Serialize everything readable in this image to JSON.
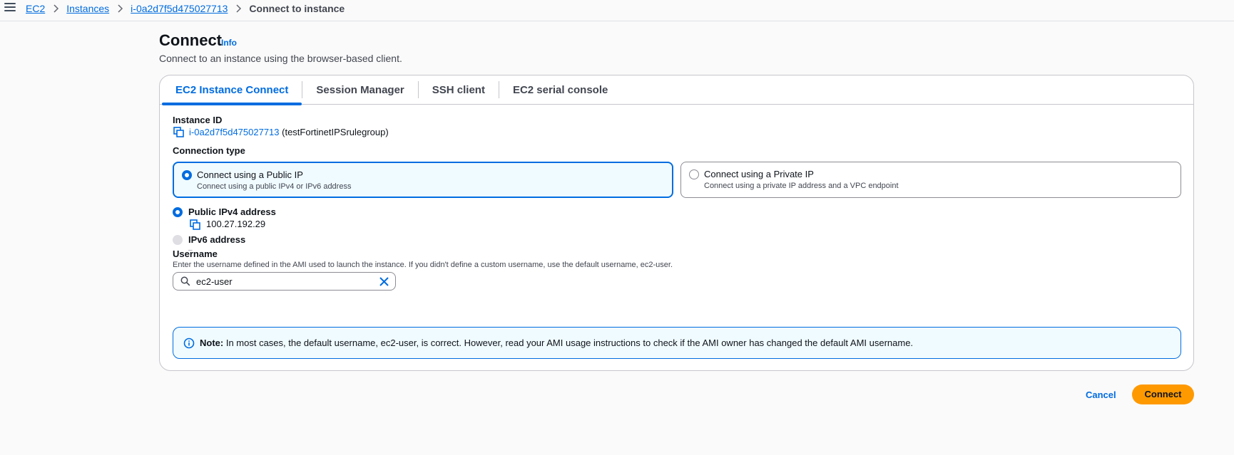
{
  "breadcrumb": {
    "items": [
      "EC2",
      "Instances",
      "i-0a2d7f5d475027713"
    ],
    "current": "Connect to instance"
  },
  "header": {
    "title": "Connect",
    "info": "Info",
    "description": "Connect to an instance using the browser-based client."
  },
  "tabs": [
    {
      "label": "EC2 Instance Connect",
      "active": true
    },
    {
      "label": "Session Manager",
      "active": false
    },
    {
      "label": "SSH client",
      "active": false
    },
    {
      "label": "EC2 serial console",
      "active": false
    }
  ],
  "instance": {
    "label": "Instance ID",
    "id": "i-0a2d7f5d475027713",
    "name": "(testFortinetIPSrulegroup)"
  },
  "connection_type": {
    "label": "Connection type",
    "options": [
      {
        "title": "Connect using a Public IP",
        "description": "Connect using a public IPv4 or IPv6 address",
        "selected": true
      },
      {
        "title": "Connect using a Private IP",
        "description": "Connect using a private IP address and a VPC endpoint",
        "selected": false
      }
    ]
  },
  "ip_options": {
    "ipv4": {
      "label": "Public IPv4 address",
      "value": "100.27.192.29",
      "selected": true
    },
    "ipv6": {
      "label": "IPv6 address",
      "value": "–",
      "selected": false
    }
  },
  "username": {
    "label": "Username",
    "hint": "Enter the username defined in the AMI used to launch the instance. If you didn't define a custom username, use the default username, ec2-user.",
    "value": "ec2-user"
  },
  "alert": {
    "prefix": "Note:",
    "text": " In most cases, the default username, ec2-user, is correct. However, read your AMI usage instructions to check if the AMI owner has changed the default AMI username."
  },
  "actions": {
    "cancel": "Cancel",
    "connect": "Connect"
  },
  "colors": {
    "accent": "#006ce0",
    "primary_button": "#ff9900",
    "selected_tile_bg": "#f0fbff"
  }
}
